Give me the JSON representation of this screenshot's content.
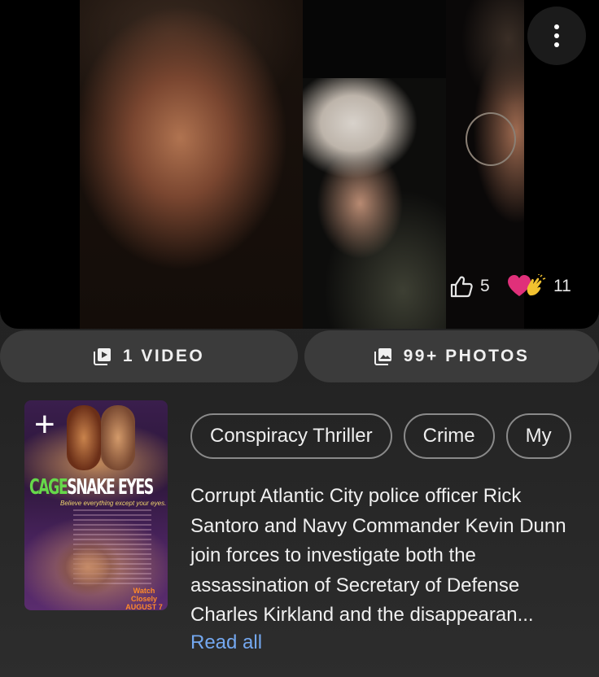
{
  "video": {
    "more_icon": "more-vertical-icon",
    "like_icon": "thumbs-up-icon",
    "like_count": "5",
    "reaction_icon": "heart-clap-icon",
    "reaction_count": "11"
  },
  "media": {
    "videos_label": "1 VIDEO",
    "videos_icon": "video-library-icon",
    "photos_label": "99+ PHOTOS",
    "photos_icon": "photo-library-icon"
  },
  "poster": {
    "title_part1": "CAGE",
    "title_part2": "SNAKE EYES",
    "tagline": "Believe everything except your eyes.",
    "date_line1": "Watch Closely",
    "date_line2": "AUGUST 7",
    "add_icon": "plus-icon",
    "add_symbol": "+"
  },
  "genres": [
    "Conspiracy Thriller",
    "Crime",
    "My"
  ],
  "synopsis": {
    "text": "Corrupt Atlantic City police officer Rick Santoro and Navy Commander Kevin Dunn join forces to investigate both the assassination of Secretary of Defense Charles Kirkland and the disappearan...",
    "read_all": "Read all"
  },
  "colors": {
    "accent_link": "#74a8f0",
    "pill_bg": "#3b3b3b",
    "heart": "#e0307a",
    "clap": "#f2c230"
  }
}
